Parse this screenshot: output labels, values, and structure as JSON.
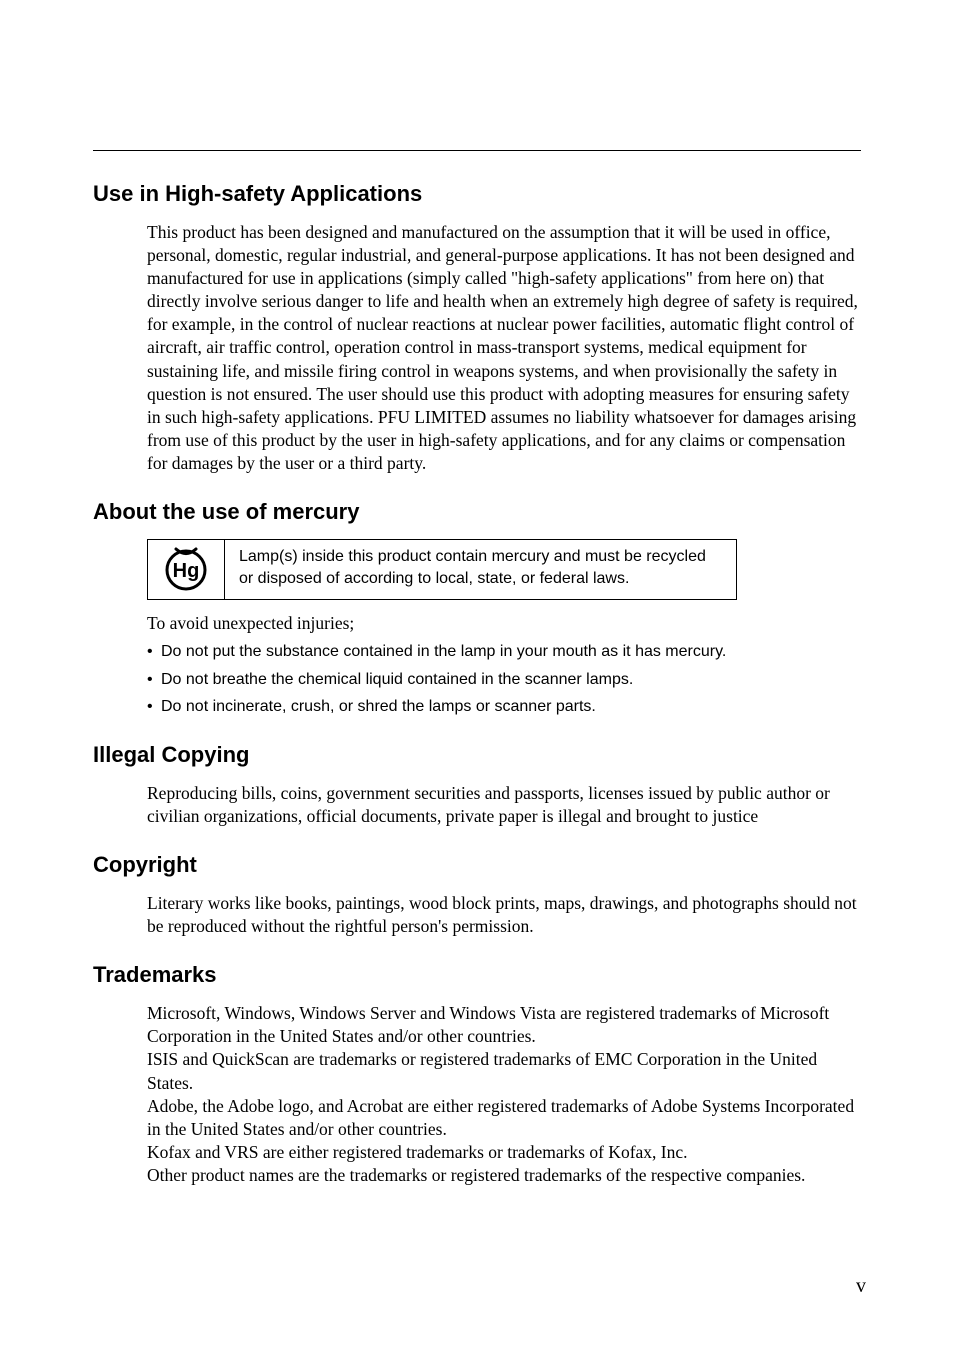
{
  "sections": {
    "high_safety": {
      "heading": "Use in High-safety Applications",
      "body": "This product has been designed and manufactured on the assumption that it will be used in office, personal, domestic, regular industrial, and general-purpose applications. It has not been designed and manufactured for use in applications (simply called \"high-safety applications\" from here on) that directly involve serious danger to life and health when an extremely high degree of safety is required, for example, in the control of nuclear reactions at nuclear power facilities, automatic flight control of aircraft, air traffic control, operation control in mass-transport systems, medical equipment for sustaining life, and missile firing control in weapons systems, and when provisionally the safety in question is not ensured. The user should use this product with adopting measures for ensuring safety in such high-safety applications. PFU LIMITED assumes no liability whatsoever for damages arising from use of this product by the user in high-safety applications, and for any claims or compensation for damages by the user or a third party."
    },
    "mercury": {
      "heading": "About the use of mercury",
      "icon_label": "Hg",
      "box_text": "Lamp(s) inside this product contain mercury and must be recycled or disposed of according to local, state, or federal laws.",
      "avoid": "To avoid unexpected injuries;",
      "bullets": [
        "Do not put the substance contained in the lamp in your mouth as it has mercury.",
        "Do not breathe the chemical liquid contained in the scanner lamps.",
        "Do not incinerate, crush, or shred the lamps or scanner parts."
      ]
    },
    "illegal": {
      "heading": "Illegal Copying",
      "body": "Reproducing bills, coins, government securities and passports, licenses issued by public author or civilian organizations, official documents, private paper is illegal and brought to justice"
    },
    "copyright": {
      "heading": "Copyright",
      "body": "Literary works like books, paintings, wood block prints, maps, drawings, and photographs should not be reproduced without the rightful person's permission."
    },
    "trademarks": {
      "heading": "Trademarks",
      "lines": [
        "Microsoft, Windows, Windows Server and Windows Vista are registered trademarks of Microsoft Corporation in the United States and/or other countries.",
        "ISIS and QuickScan are trademarks or registered trademarks of EMC Corporation in the United States.",
        "Adobe, the Adobe logo, and Acrobat are either registered trademarks of Adobe Systems Incorporated in the United States and/or other countries.",
        "Kofax and VRS are either registered trademarks or trademarks of Kofax, Inc.",
        "Other product names are the trademarks or registered trademarks of the respective companies."
      ]
    }
  },
  "page_number": "v"
}
